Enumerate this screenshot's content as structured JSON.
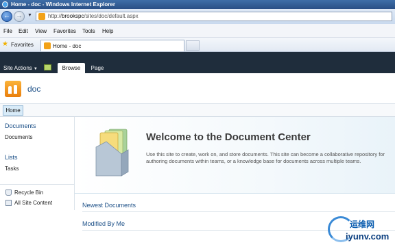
{
  "window": {
    "title": "Home - doc - Windows Internet Explorer"
  },
  "address_bar": {
    "url_prefix": "http://",
    "url_host": "brookspc",
    "url_path": "/sites/doc/default.aspx"
  },
  "menu": {
    "items": [
      "File",
      "Edit",
      "View",
      "Favorites",
      "Tools",
      "Help"
    ]
  },
  "favorites_bar": {
    "label": "Favorites",
    "tab_label": "Home - doc"
  },
  "ribbon": {
    "site_actions": "Site Actions",
    "tabs": [
      "Browse",
      "Page"
    ]
  },
  "site": {
    "title": "doc"
  },
  "top_nav": {
    "home": "Home"
  },
  "quick_launch": {
    "documents_heading": "Documents",
    "documents_item": "Documents",
    "lists_heading": "Lists",
    "lists_item": "Tasks",
    "recycle_bin": "Recycle Bin",
    "all_site_content": "All Site Content"
  },
  "main": {
    "welcome_title": "Welcome to the Document Center",
    "welcome_text": "Use this site to create, work on, and store documents. This site can become a collaborative repository for authoring documents within teams, or a knowledge base for documents across multiple teams.",
    "webparts": [
      "Newest Documents",
      "Modified By Me"
    ]
  },
  "watermark": {
    "chinese": "运维网",
    "latin": "iyunv.com"
  },
  "colors": {
    "ribbon_bg": "#1f2d3c",
    "link_blue": "#1a4e86",
    "site_logo": "#f2a218"
  }
}
